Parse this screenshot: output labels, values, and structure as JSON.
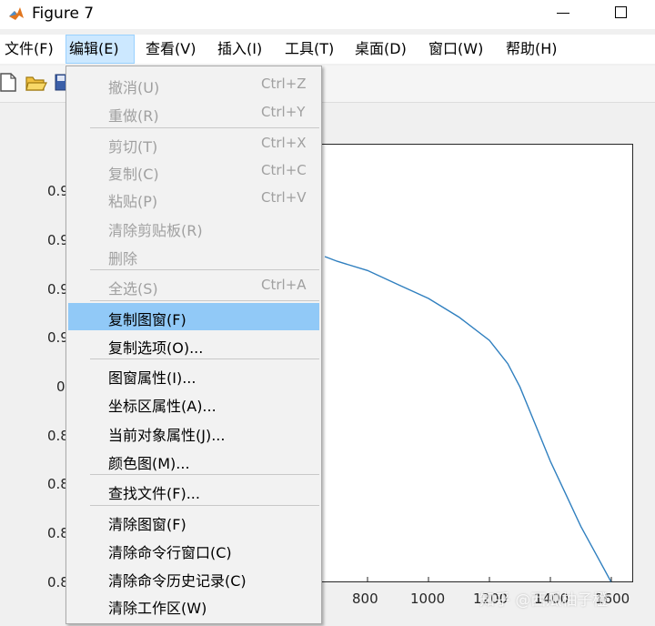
{
  "window": {
    "title": "Figure 7"
  },
  "menubar": {
    "items": [
      {
        "label": "文件(F)"
      },
      {
        "label": "编辑(E)"
      },
      {
        "label": "查看(V)"
      },
      {
        "label": "插入(I)"
      },
      {
        "label": "工具(T)"
      },
      {
        "label": "桌面(D)"
      },
      {
        "label": "窗口(W)"
      },
      {
        "label": "帮助(H)"
      }
    ],
    "active_index": 1
  },
  "toolbar": {
    "icons": [
      "new-file-icon",
      "open-folder-icon",
      "save-icon"
    ]
  },
  "edit_menu": {
    "items": [
      {
        "label": "撤消(U)",
        "shortcut": "Ctrl+Z",
        "enabled": false
      },
      {
        "label": "重做(R)",
        "shortcut": "Ctrl+Y",
        "enabled": false
      },
      {
        "label": "剪切(T)",
        "shortcut": "Ctrl+X",
        "enabled": false
      },
      {
        "label": "复制(C)",
        "shortcut": "Ctrl+C",
        "enabled": false
      },
      {
        "label": "粘贴(P)",
        "shortcut": "Ctrl+V",
        "enabled": false
      },
      {
        "label": "清除剪贴板(R)",
        "shortcut": "",
        "enabled": false
      },
      {
        "label": "删除",
        "shortcut": "",
        "enabled": false
      },
      {
        "label": "全选(S)",
        "shortcut": "Ctrl+A",
        "enabled": false
      },
      {
        "label": "复制图窗(F)",
        "shortcut": "",
        "enabled": true,
        "highlighted": true
      },
      {
        "label": "复制选项(O)...",
        "shortcut": "",
        "enabled": true
      },
      {
        "label": "图窗属性(I)...",
        "shortcut": "",
        "enabled": true
      },
      {
        "label": "坐标区属性(A)...",
        "shortcut": "",
        "enabled": true
      },
      {
        "label": "当前对象属性(J)...",
        "shortcut": "",
        "enabled": true
      },
      {
        "label": "颜色图(M)...",
        "shortcut": "",
        "enabled": true
      },
      {
        "label": "查找文件(F)...",
        "shortcut": "",
        "enabled": true
      },
      {
        "label": "清除图窗(F)",
        "shortcut": "",
        "enabled": true
      },
      {
        "label": "清除命令行窗口(C)",
        "shortcut": "",
        "enabled": true
      },
      {
        "label": "清除命令历史记录(C)",
        "shortcut": "",
        "enabled": true
      },
      {
        "label": "清除工作区(W)",
        "shortcut": "",
        "enabled": true
      }
    ]
  },
  "axes": {
    "ytick_labels": [
      "0.9",
      "0.9",
      "0.9",
      "0.9",
      "0",
      "0.8",
      "0.8",
      "0.8",
      "0.8"
    ],
    "xtick_labels": [
      "800",
      "1000",
      "1200",
      "1400",
      "1600"
    ]
  },
  "watermark": "知乎 @西瓜柚子橙",
  "colors": {
    "line": "#2f7fbf",
    "highlight": "#91c9f7",
    "menu_active": "#cce8ff"
  },
  "chart_data": {
    "type": "line",
    "title": "",
    "xlabel": "",
    "ylabel": "",
    "xticks": [
      800,
      1000,
      1200,
      1400,
      1600
    ],
    "series": [
      {
        "x": [
          660,
          700,
          800,
          900,
          1000,
          1100,
          1200,
          1260,
          1300,
          1350,
          1400,
          1450,
          1500,
          1550,
          1600
        ],
        "y": [
          0.9,
          0.899,
          0.897,
          0.894,
          0.891,
          0.887,
          0.882,
          0.877,
          0.872,
          0.864,
          0.856,
          0.849,
          0.842,
          0.836,
          0.83
        ]
      }
    ]
  }
}
